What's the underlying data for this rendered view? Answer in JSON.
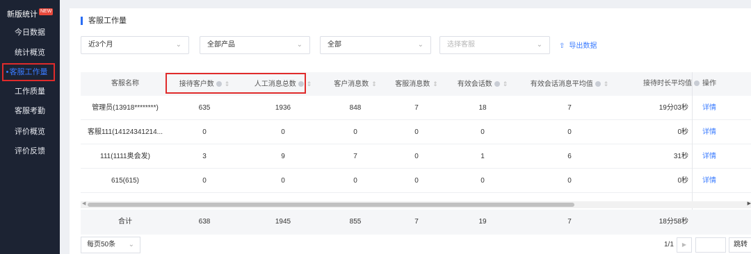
{
  "sidebar": {
    "header": "新版统计",
    "new_badge": "NEW",
    "items": [
      {
        "label": "今日数据"
      },
      {
        "label": "统计概览"
      },
      {
        "label": "客服工作量"
      },
      {
        "label": "工作质量"
      },
      {
        "label": "客服考勤"
      },
      {
        "label": "评价概览"
      },
      {
        "label": "评价反馈"
      }
    ]
  },
  "page": {
    "title": "客服工作量"
  },
  "filters": {
    "period": "近3个月",
    "product": "全部产品",
    "scope": "全部",
    "agent_placeholder": "选择客服",
    "export_label": "导出数据"
  },
  "table": {
    "columns": [
      "客服名称",
      "接待客户数",
      "人工消息总数",
      "客户消息数",
      "客服消息数",
      "有效会话数",
      "有效会话消息平均值",
      "接待时长平均值",
      "操作"
    ],
    "rows": [
      {
        "name": "管理员(13918********)",
        "c1": "635",
        "c2": "1936",
        "c3": "848",
        "c4": "7",
        "c5": "18",
        "c6": "7",
        "c7": "19分03秒",
        "action": "详情"
      },
      {
        "name": "客服111(14124341214...",
        "c1": "0",
        "c2": "0",
        "c3": "0",
        "c4": "0",
        "c5": "0",
        "c6": "0",
        "c7": "0秒",
        "action": "详情"
      },
      {
        "name": "111(1111奥会发)",
        "c1": "3",
        "c2": "9",
        "c3": "7",
        "c4": "0",
        "c5": "1",
        "c6": "6",
        "c7": "31秒",
        "action": "详情"
      },
      {
        "name": "615(615)",
        "c1": "0",
        "c2": "0",
        "c3": "0",
        "c4": "0",
        "c5": "0",
        "c6": "0",
        "c7": "0秒",
        "action": "详情"
      }
    ],
    "total": {
      "label": "合计",
      "c1": "638",
      "c2": "1945",
      "c3": "855",
      "c4": "7",
      "c5": "19",
      "c6": "7",
      "c7": "18分58秒"
    }
  },
  "pagination": {
    "page_size": "每页50条",
    "page_info": "1/1",
    "jump_label": "跳转"
  },
  "colors": {
    "accent": "#3a7bff",
    "highlight": "#e02b2b",
    "sidebar": "#1c2333"
  }
}
